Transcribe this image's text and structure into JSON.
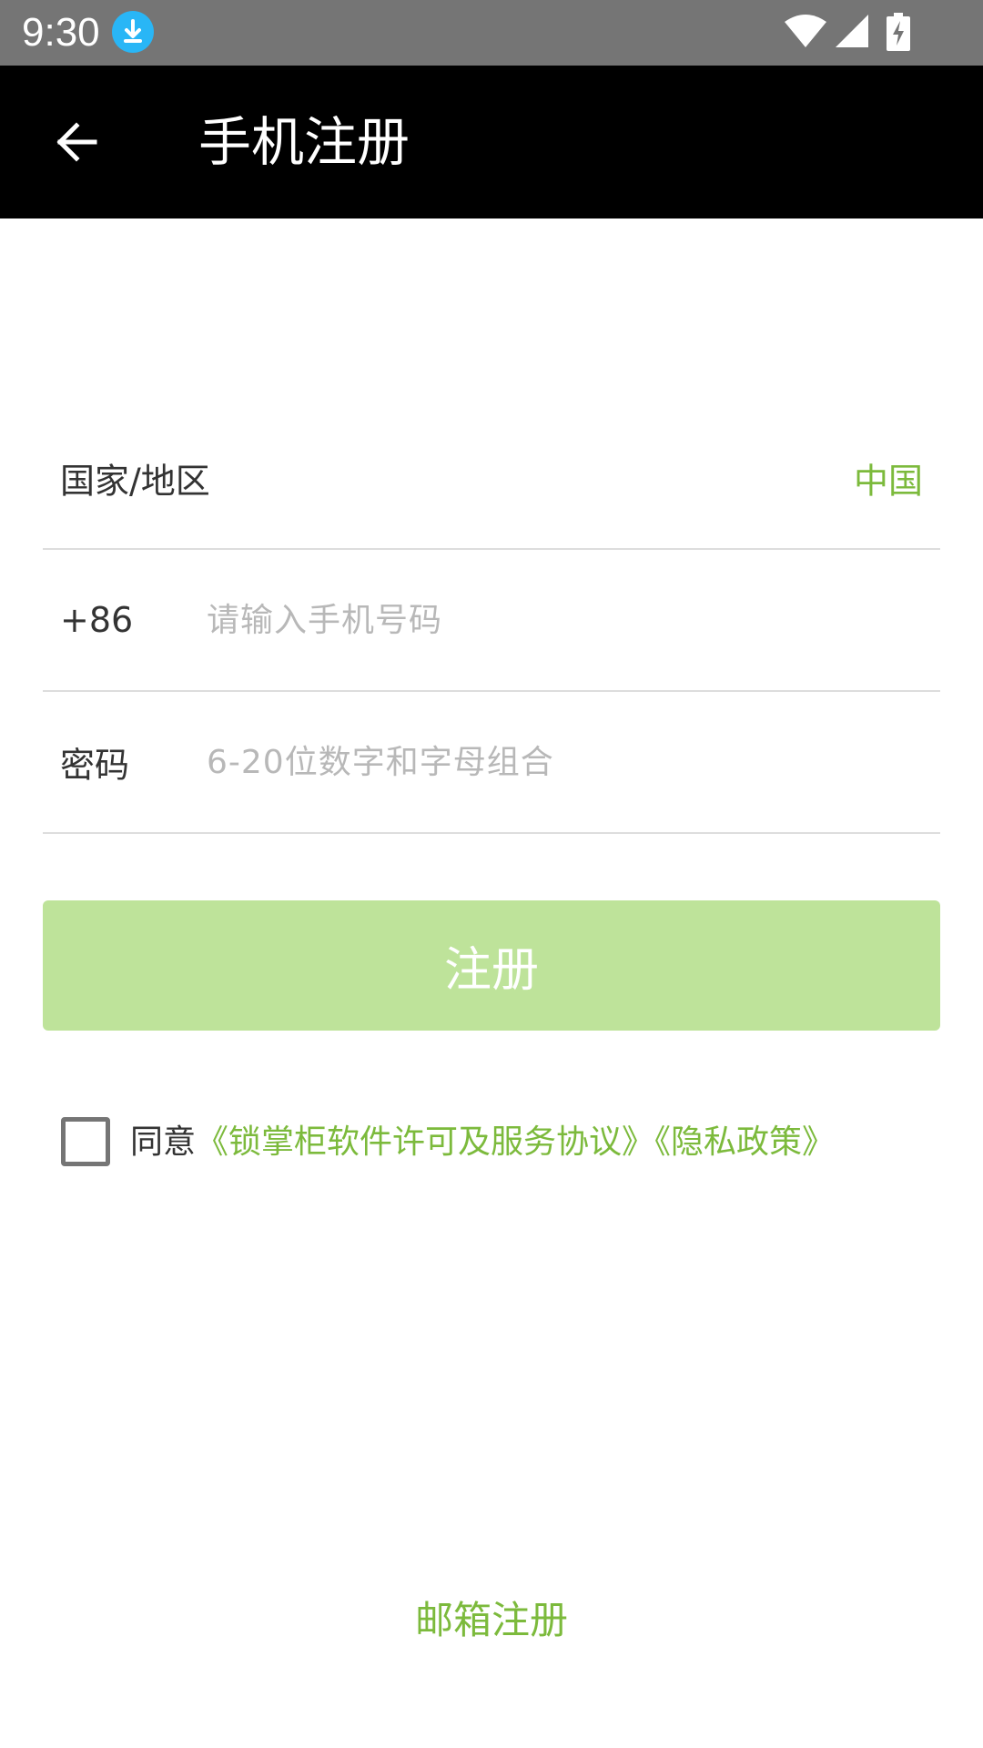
{
  "status_bar": {
    "time": "9:30",
    "icons": [
      "download-icon",
      "wifi-icon",
      "signal-icon",
      "battery-charging-icon"
    ]
  },
  "app_bar": {
    "title": "手机注册",
    "back_icon": "arrow-left-icon"
  },
  "form": {
    "country": {
      "label": "国家/地区",
      "value": "中国"
    },
    "phone": {
      "prefix": "+86",
      "value": "",
      "placeholder": "请输入手机号码"
    },
    "password": {
      "label": "密码",
      "value": "",
      "placeholder": "6-20位数字和字母组合"
    }
  },
  "register_button": {
    "label": "注册"
  },
  "agreement": {
    "checked": false,
    "prefix": "同意",
    "license_link": "《锁掌柜软件许可及服务协议》",
    "privacy_link": "《隐私政策》"
  },
  "email_register": {
    "label": "邮箱注册"
  },
  "colors": {
    "accent": "#7cba3c",
    "button_disabled": "#bee39a",
    "app_bar": "#000000",
    "status_bar": "#757575"
  }
}
